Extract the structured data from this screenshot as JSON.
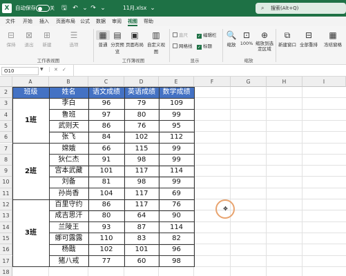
{
  "titlebar": {
    "logo": "X",
    "autosave_label": "自动保存",
    "toggle_state": "关",
    "filename": "11月.xlsx",
    "search_placeholder": "搜索(Alt+Q)"
  },
  "tabs": [
    "文件",
    "开始",
    "插入",
    "页面布局",
    "公式",
    "数据",
    "审阅",
    "视图",
    "帮助"
  ],
  "active_tab": "视图",
  "ribbon": {
    "sheet_view": {
      "items": [
        "保持",
        "退出",
        "新建",
        "选项"
      ],
      "label": "工作表视图"
    },
    "workbook_views": {
      "items": [
        "普通",
        "分页预览",
        "页面布局",
        "自定义视图"
      ],
      "label": "工作簿视图"
    },
    "show": {
      "checks": [
        {
          "label": "直尺",
          "checked": false,
          "enabled": false
        },
        {
          "label": "编辑栏",
          "checked": true,
          "enabled": true
        },
        {
          "label": "网格线",
          "checked": false,
          "enabled": true
        },
        {
          "label": "标题",
          "checked": true,
          "enabled": true
        }
      ],
      "label": "显示"
    },
    "zoom": {
      "items": [
        "缩放",
        "100%",
        "缩放到选定区域"
      ],
      "label": "缩放"
    },
    "window": {
      "items": [
        "新建窗口",
        "全部重排",
        "冻结窗格"
      ]
    }
  },
  "formula_bar": {
    "name_box": "O10",
    "formula": ""
  },
  "columns": [
    "A",
    "B",
    "C",
    "D",
    "E",
    "F",
    "G",
    "H",
    "I"
  ],
  "rows": [
    "2",
    "3",
    "4",
    "5",
    "6",
    "7",
    "8",
    "9",
    "10",
    "11",
    "12",
    "13",
    "14",
    "15",
    "16",
    "17",
    "18"
  ],
  "table": {
    "headers": [
      "班级",
      "姓名",
      "语文成绩",
      "英语成绩",
      "数学成绩"
    ],
    "groups": [
      {
        "class": "1班",
        "rows": [
          [
            "李白",
            "96",
            "79",
            "109"
          ],
          [
            "鲁班",
            "97",
            "80",
            "99"
          ],
          [
            "武则天",
            "86",
            "76",
            "95"
          ],
          [
            "张飞",
            "84",
            "102",
            "112"
          ]
        ]
      },
      {
        "class": "2班",
        "rows": [
          [
            "嫦娥",
            "66",
            "115",
            "99"
          ],
          [
            "狄仁杰",
            "91",
            "98",
            "99"
          ],
          [
            "宫本武藏",
            "101",
            "117",
            "114"
          ],
          [
            "刘备",
            "81",
            "98",
            "99"
          ],
          [
            "孙尚香",
            "104",
            "117",
            "69"
          ]
        ]
      },
      {
        "class": "3班",
        "rows": [
          [
            "百里守约",
            "86",
            "117",
            "76"
          ],
          [
            "成吉思汗",
            "80",
            "64",
            "90"
          ],
          [
            "兰陵王",
            "93",
            "87",
            "114"
          ],
          [
            "娜可露露",
            "110",
            "83",
            "82"
          ],
          [
            "杨戬",
            "102",
            "101",
            "96"
          ],
          [
            "猪八戒",
            "77",
            "60",
            "98"
          ]
        ]
      }
    ]
  },
  "colors": {
    "titlebar": "#1e7145",
    "header_fill": "#4472c4",
    "cursor_ring": "#e8a36e"
  }
}
